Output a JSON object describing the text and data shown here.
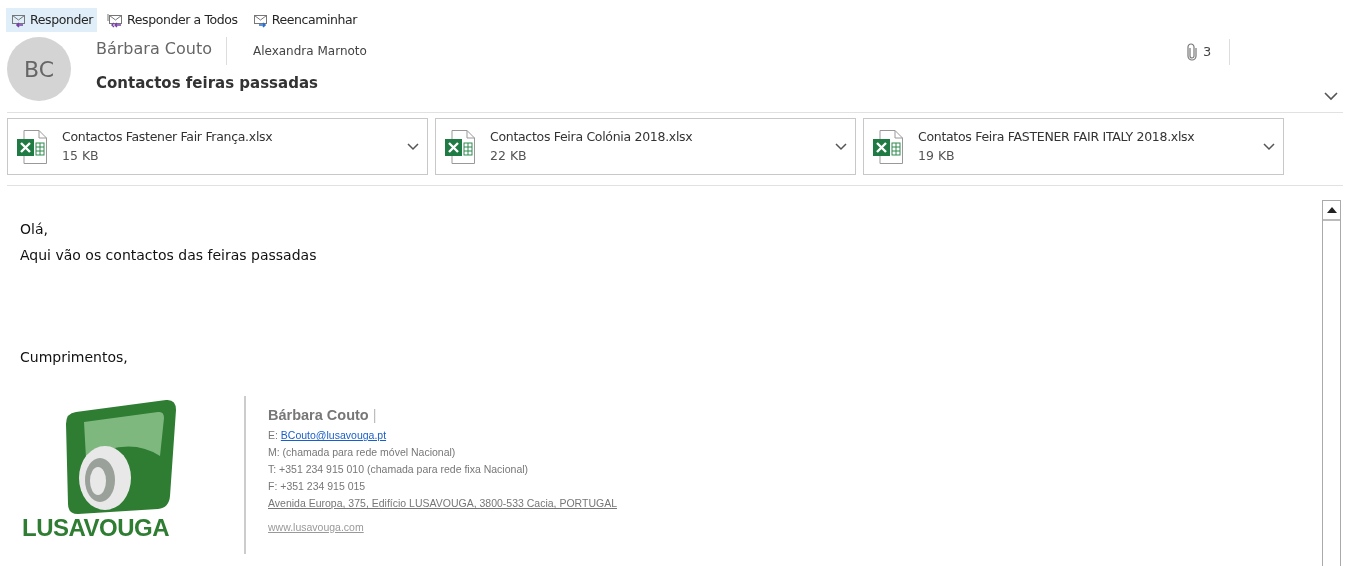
{
  "toolbar": [
    {
      "label": "Responder",
      "kind": "reply",
      "selected": true
    },
    {
      "label": "Responder a Todos",
      "kind": "reply-all",
      "selected": false
    },
    {
      "label": "Reencaminhar",
      "kind": "forward",
      "selected": false
    }
  ],
  "message": {
    "avatar_initials": "BC",
    "sender": "Bárbara Couto",
    "recipient": "Alexandra Marnoto",
    "subject": "Contactos feiras passadas",
    "attachment_count": "3"
  },
  "attachments": [
    {
      "name": "Contactos Fastener Fair França.xlsx",
      "size": "15 KB"
    },
    {
      "name": "Contactos Feira Colónia 2018.xlsx",
      "size": "22 KB"
    },
    {
      "name": "Contatos Feira FASTENER FAIR ITALY 2018.xlsx",
      "size": "19 KB"
    }
  ],
  "body": {
    "paragraphs": [
      "Olá,",
      "Aqui vão os contactos das feiras passadas"
    ],
    "closing": "Cumprimentos,"
  },
  "signature": {
    "logo_text": "LUSAVOUGA",
    "name": "Bárbara Couto",
    "name_separator": "|",
    "lines": [
      {
        "kind": "email",
        "prefix": "E:",
        "text": "BCouto@lusavouga.pt"
      },
      {
        "kind": "plain",
        "text": "M: (chamada para rede móvel Nacional)"
      },
      {
        "kind": "plain",
        "text": "T: +351 234 915 010 (chamada para rede fixa Nacional)"
      },
      {
        "kind": "plain",
        "text": "F: +351 234 915 015"
      },
      {
        "kind": "address",
        "text": "Avenida Europa, 375, Edifício LUSAVOUGA, 3800-533 Cacia, PORTUGAL"
      },
      {
        "kind": "website",
        "text": "www.lusavouga.com"
      }
    ]
  }
}
